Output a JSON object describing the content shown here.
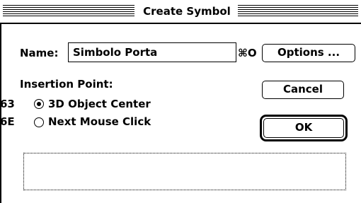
{
  "dialog": {
    "title": "Create Symbol",
    "name_label": "Name:",
    "name_value": "Simbolo Porta",
    "name_shortcut": "⌘O",
    "options_label": "Options ...",
    "insertion_heading": "Insertion Point:",
    "options_radio": [
      {
        "shortcut": "63",
        "label": "3D Object Center",
        "checked": true
      },
      {
        "shortcut": "6E",
        "label": "Next Mouse Click",
        "checked": false
      }
    ],
    "cancel_label": "Cancel",
    "ok_label": "OK",
    "message": ""
  }
}
